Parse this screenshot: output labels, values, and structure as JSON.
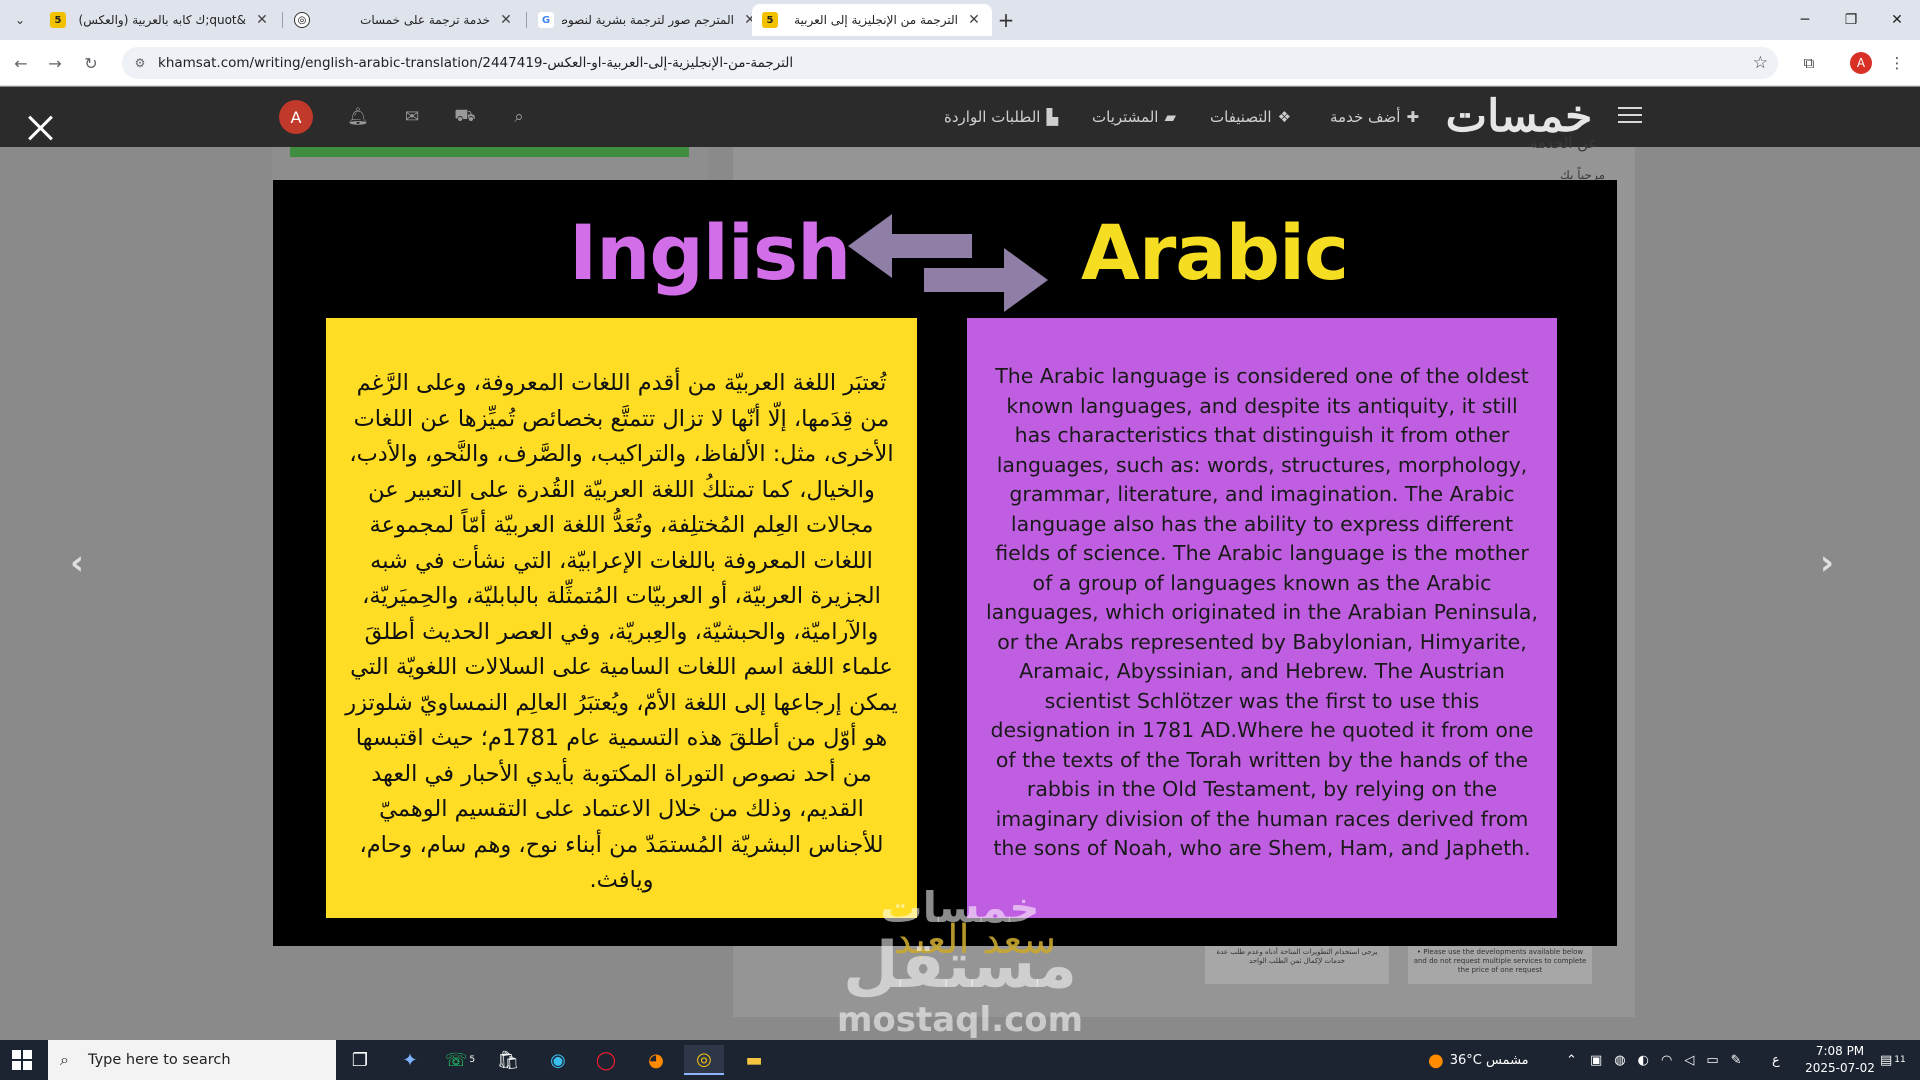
{
  "browser": {
    "tabs": [
      {
        "title": "&quot;ك كابه بالعربية (والعكس)",
        "favicon": "5",
        "active": false
      },
      {
        "title": "خدمة ترجمة على خمسات",
        "favicon": "◎",
        "active": false
      },
      {
        "title": "المترجم صور لترجمة بشرية لنصوص",
        "favicon": "G",
        "active": false
      },
      {
        "title": "الترجمة من الإنجليزية إلى العربية",
        "favicon": "5",
        "active": true
      }
    ],
    "url": "khamsat.com/writing/english-arabic-translation/2447419-الترجمة-من-الإنجليزية-إلى-العربية-او-العكس",
    "profile_initial": "A"
  },
  "site": {
    "logo": "خمسات",
    "logo_five": "5",
    "nav": {
      "add_service": "أضف خدمة",
      "categories": "التصنيفات",
      "purchases": "المشتريات",
      "incoming_requests": "الطلبات الواردة"
    },
    "avatar_initial": "A",
    "bg_text_1": "عن الخدمة",
    "bg_text_2": "مرحباً بك",
    "thumb_1": "يرجى استخدام التطويرات المتاحة أدناه وعدم طلب عدة خدمات لإكمال ثمن الطلب الواحد",
    "thumb_2": "• Please use the developments available below and do not request multiple services to complete the price of one request"
  },
  "lightbox": {
    "title_left": "Inglish",
    "title_right": "Arabic",
    "arabic_paragraph": "تُعتبَر اللغة العربيّة من أقدم اللغات المعروفة، وعلى الرَّغم من قِدَمها، إلّا أنّها لا تزال تتمتَّع بخصائص تُميِّزها عن اللغات الأخرى، مثل: الألفاظ، والتراكيب، والصَّرف، والنَّحو، والأدب، والخيال، كما تمتلكُ اللغة العربيّة القُدرة على التعبير عن مجالات العِلم المُختلِفة، وتُعَدُّ اللغة العربيّة أمّاً لمجموعة اللغات المعروفة باللغات الإعرابيّة، التي نشأت في شبه الجزيرة العربيّة، أو العربيّات المُتمثِّلة بالبابليّة، والحِميَريّة، والآراميّة، والحبشيّة، والعِبريّة، وفي العصر الحديث أطلقَ علماء اللغة اسم اللغات السامية على السلالات اللغويّة التي يمكن إرجاعها إلى اللغة الأمّ، ويُعتبَرُ العالِم النمساويّ شلوتزر هو أوّل من أطلقَ هذه التسمية عام 1781م؛ حيث اقتبسها من أحد نصوص التوراة المكتوبة بأيدي الأحبار في العهد القديم، وذلك من خلال الاعتماد على التقسيم الوهميّ للأجناس البشريّة المُستمَدّ من أبناء نوح، وهم سام، وحام، ويافث.",
    "english_paragraph": "The Arabic language is considered one of the oldest known languages, and despite its antiquity, it still has characteristics that distinguish it from other languages, such as: words, structures, morphology, grammar, literature, and imagination. The Arabic language also has the ability to express different fields of science. The Arabic language is the mother of a group of languages known as the Arabic languages, which originated in the Arabian Peninsula, or the Arabs represented by Babylonian, Himyarite, Aramaic, Abyssinian, and Hebrew. The Austrian scientist Schlötzer was the first to use this designation in 1781 AD.Where he quoted it from one of the texts of the Torah written by the hands of the rabbis in the Old Testament, by relying on the imaginary division of the human races derived from the sons of Noah, who are Shem, Ham, and Japheth.",
    "watermark_top": "خمسات",
    "watermark_main": "مستقل",
    "watermark_url": "mostaql.com",
    "signature": "سعد العبد"
  },
  "taskbar": {
    "search_placeholder": "Type here to search",
    "whatsapp_badge": "5",
    "weather": "36°C  مشمس",
    "lang": "ع",
    "time": "7:08 PM",
    "date": "2025-07-02",
    "notif_count": "11"
  },
  "colors": {
    "yellow": "#fedd24",
    "purple": "#c05ee2",
    "title_purple": "#d16ee8",
    "title_yellow": "#f5dd21",
    "arrow_gray": "#8f7fa6"
  }
}
